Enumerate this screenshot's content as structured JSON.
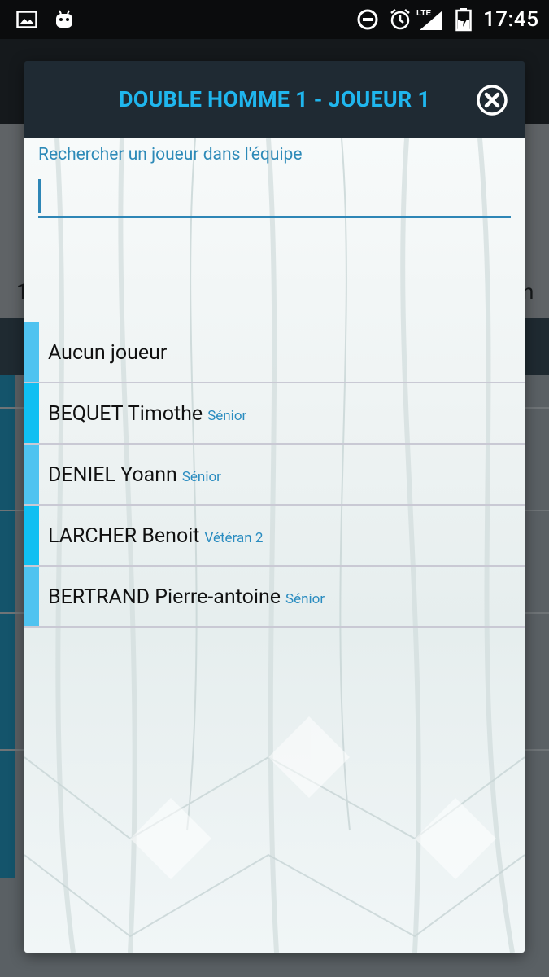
{
  "status_bar": {
    "time": "17:45",
    "network": "LTE",
    "icons": [
      "gallery-icon",
      "android-icon",
      "do-not-disturb-icon",
      "alarm-icon",
      "signal-icon",
      "battery-icon"
    ]
  },
  "background": {
    "left_text": "1",
    "right_text": "n"
  },
  "dialog": {
    "title": "DOUBLE HOMME 1 - JOUEUR 1",
    "close_icon": "close-circle-icon",
    "search": {
      "label": "Rechercher un joueur dans l'équipe",
      "value": "",
      "placeholder": ""
    },
    "players": [
      {
        "name": "Aucun joueur",
        "category": "",
        "accent": "#4fc3f0"
      },
      {
        "name": "BEQUET Timothe",
        "category": "Sénior",
        "accent": "#10bff2"
      },
      {
        "name": "DENIEL Yoann",
        "category": "Sénior",
        "accent": "#4fc3f0"
      },
      {
        "name": "LARCHER Benoit",
        "category": "Vétéran 2",
        "accent": "#10bff2"
      },
      {
        "name": "BERTRAND Pierre-antoine",
        "category": "Sénior",
        "accent": "#4fc3f0"
      }
    ]
  },
  "colors": {
    "title": "#1fb6ee",
    "header_bg": "#1f2a33",
    "input_underline": "#2e86b6",
    "category_text": "#2a8cc0"
  }
}
